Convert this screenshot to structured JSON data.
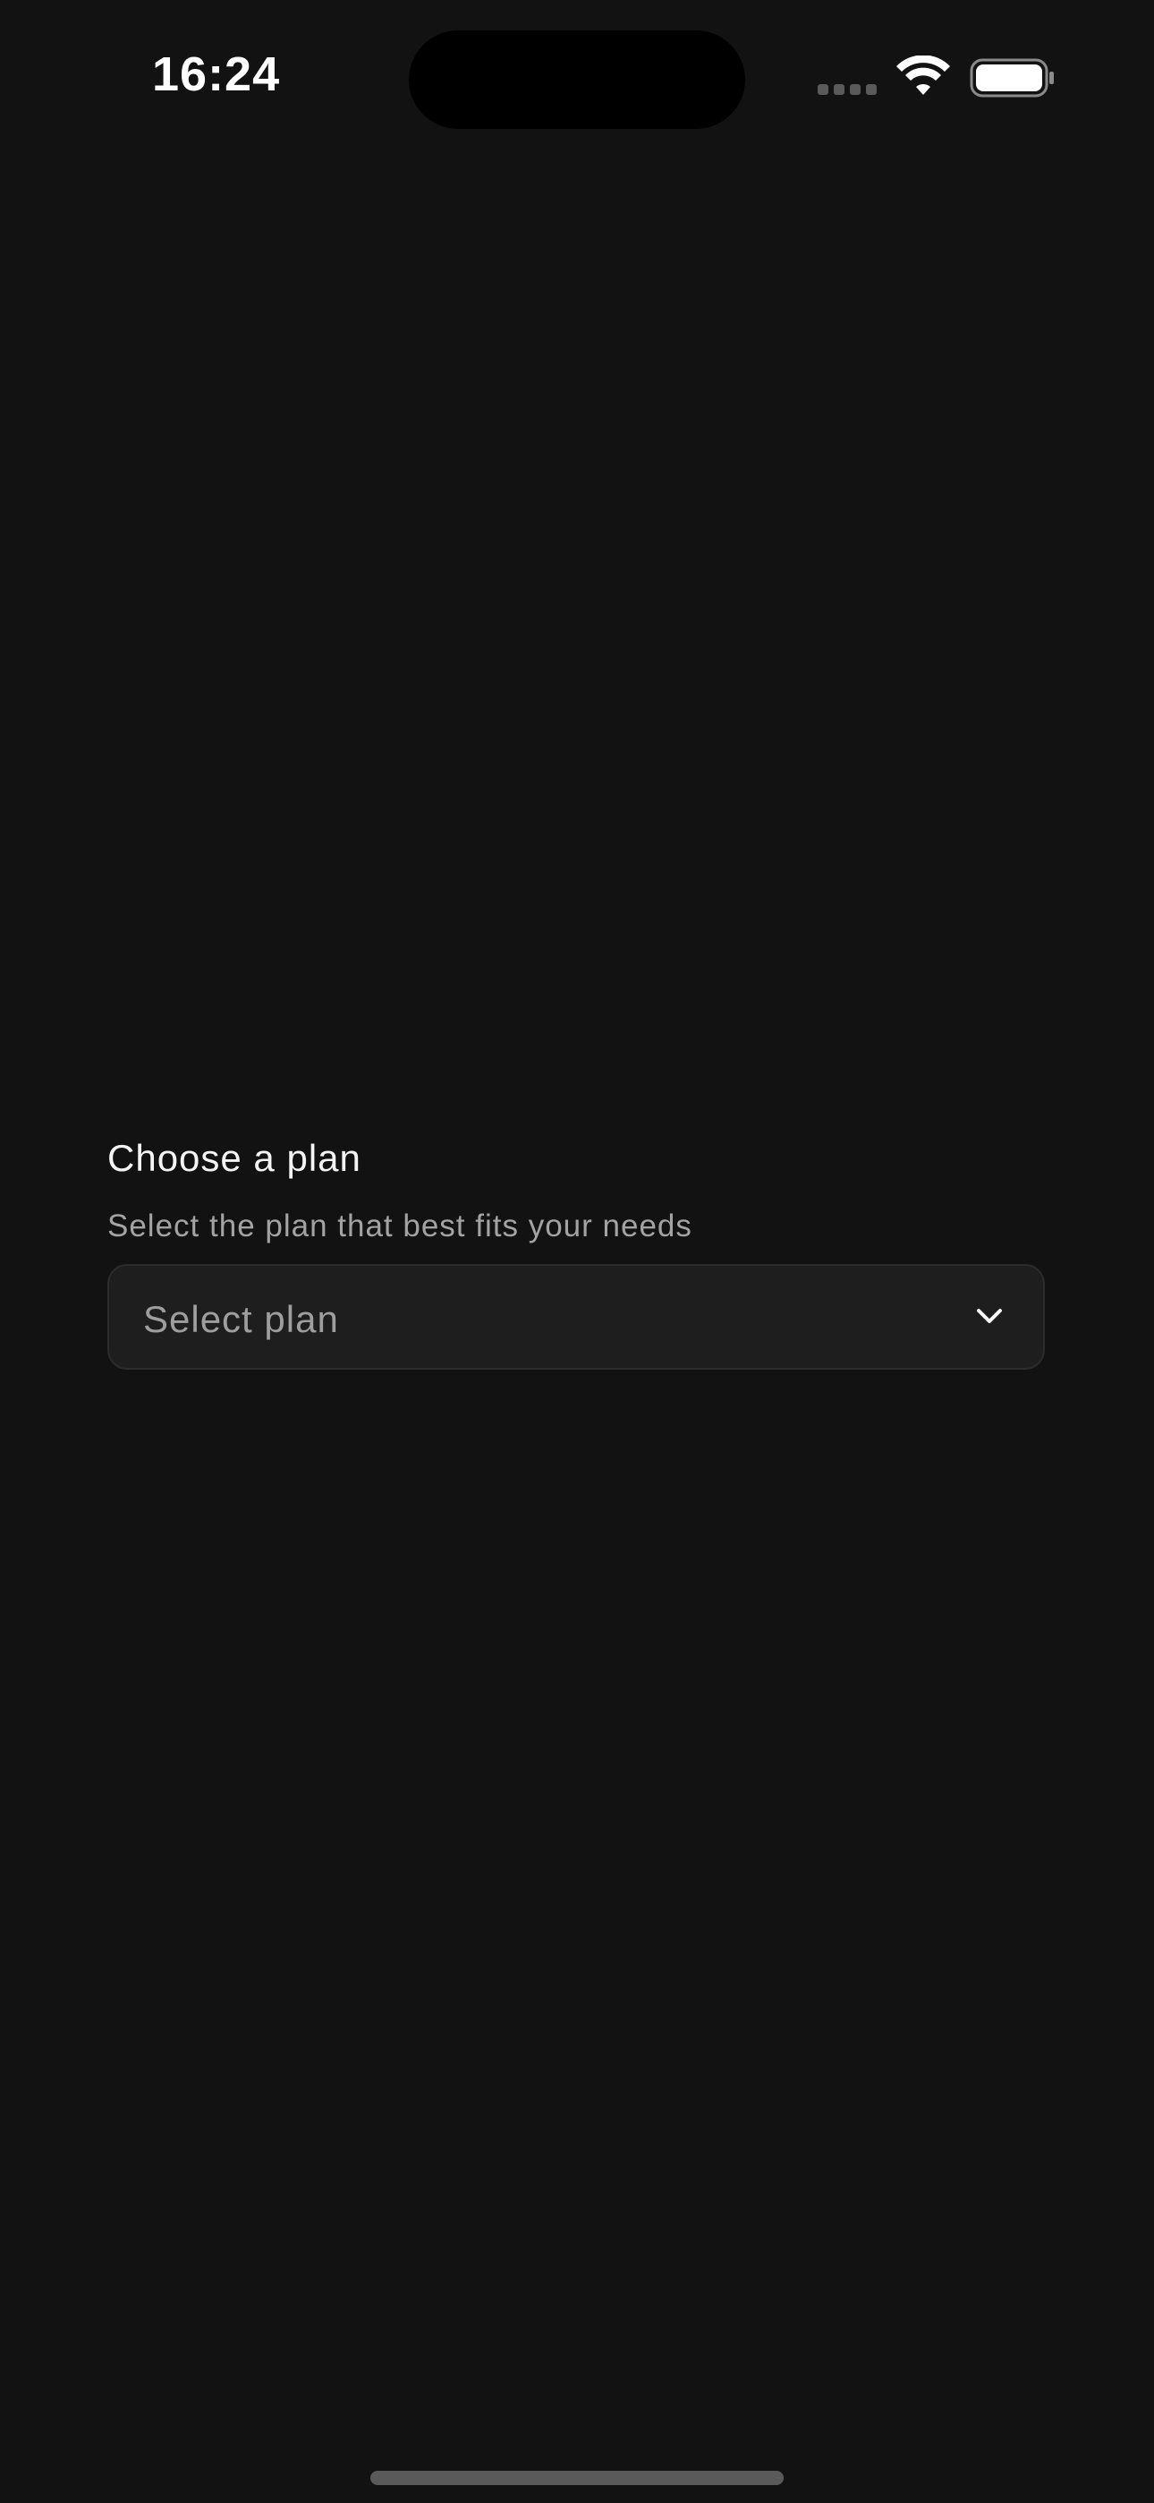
{
  "status_bar": {
    "time": "16:24",
    "signal_icon": "cellular-signal-icon",
    "wifi_icon": "wifi-icon",
    "battery_icon": "battery-full-icon"
  },
  "plan_field": {
    "label": "Choose a plan",
    "hint": "Select the plan that best fits your needs",
    "placeholder": "Select plan",
    "chevron_icon": "chevron-down-icon"
  },
  "colors": {
    "background": "#121212",
    "select_background": "#1e1e1e",
    "select_border": "#2c2c2c",
    "hint_text": "#a3a3a3",
    "placeholder_text": "#9e9e9e"
  }
}
